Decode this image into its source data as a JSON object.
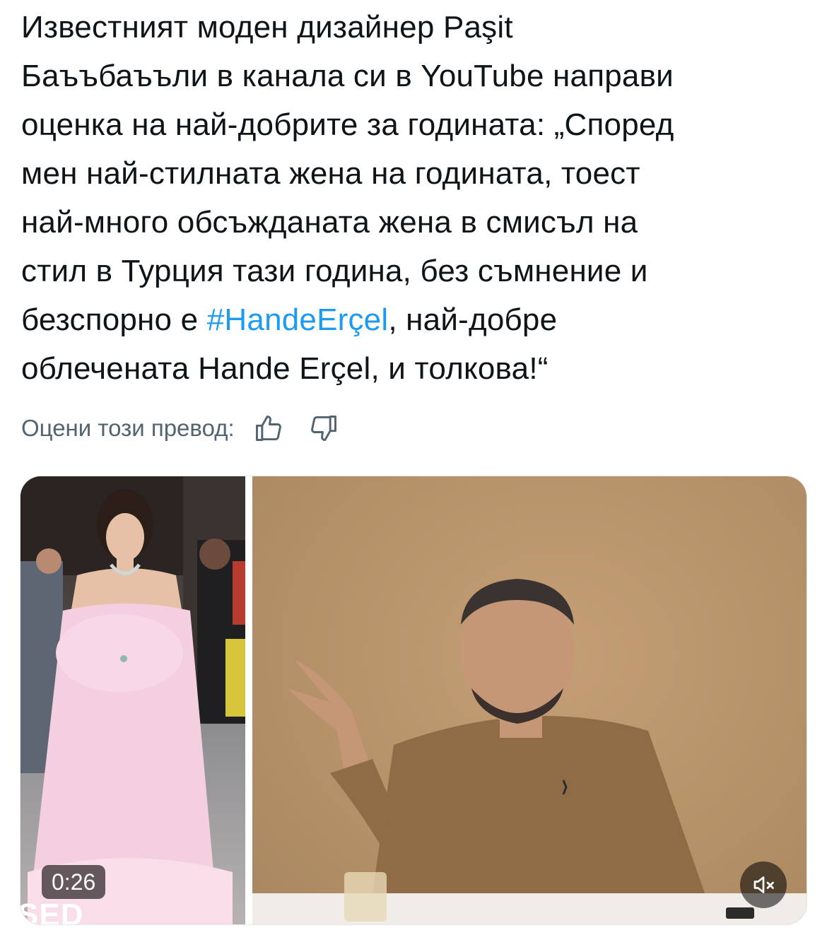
{
  "tweet": {
    "lines": [
      "Известният моден дизайнер Paşit",
      "Баъъбаъъли в канала си в YouTube направи",
      "оценка на най-добрите за годината: „Според",
      "мен най-стилната жена на годината, тоест",
      "най-много обсъжданата жена в смисъл на",
      "стил в Турция тази година, без съмнение и"
    ],
    "line7_before": "безспорно е ",
    "hashtag": "#HandeErçel",
    "line7_after": ", най-добре",
    "line8": "облечената Hande Erçel, и толкова!“"
  },
  "rating": {
    "label": "Оцени този превод:",
    "thumbs_up_icon": "thumbs-up-icon",
    "thumbs_down_icon": "thumbs-down-icon"
  },
  "media": {
    "duration": "0:26",
    "mute_icon": "speaker-muted-icon",
    "overlay_text": "SED"
  },
  "colors": {
    "text": "#0f1419",
    "secondary": "#536471",
    "link": "#1d9bf0"
  }
}
